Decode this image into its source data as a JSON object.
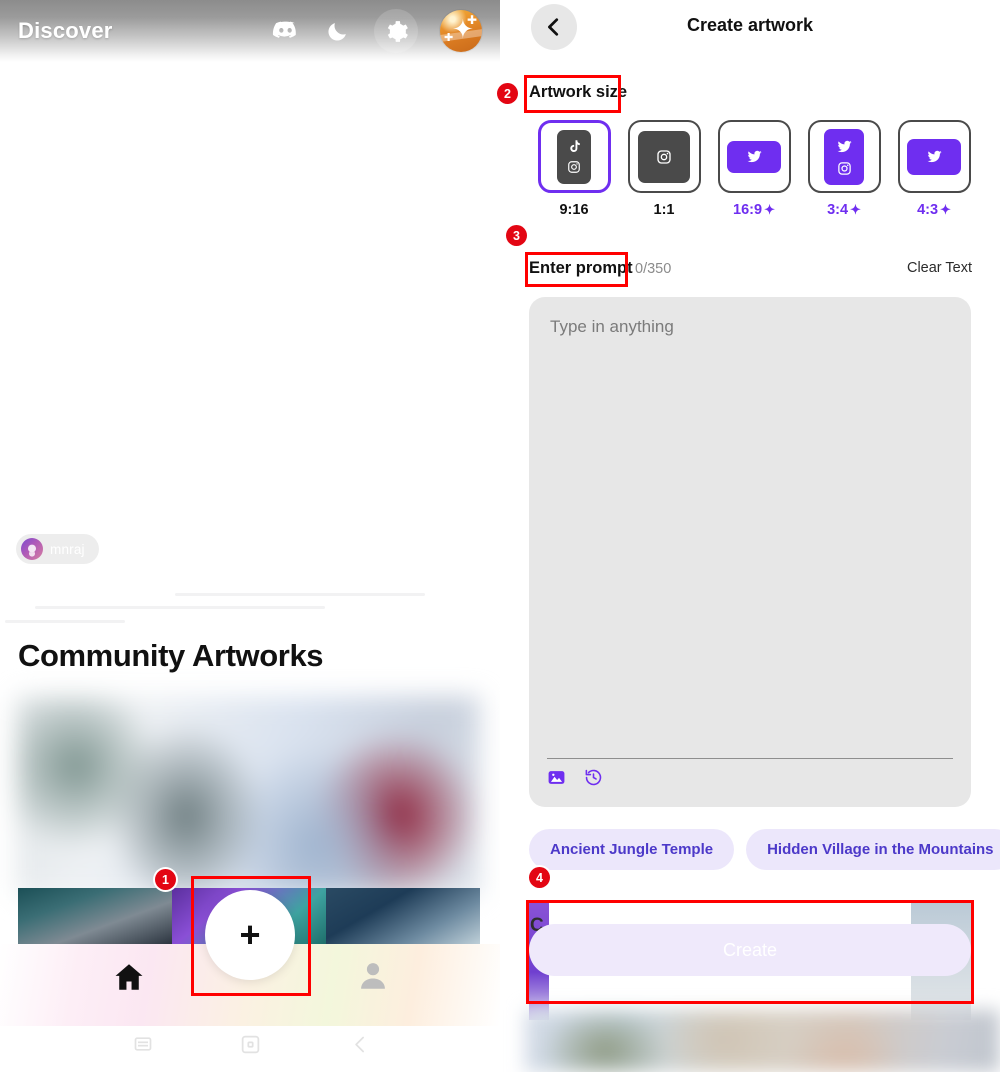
{
  "left": {
    "header": {
      "title": "Discover",
      "icons": [
        "discord-icon",
        "moon-icon",
        "gear-icon",
        "avatar"
      ]
    },
    "badge": {
      "username": "mnraj"
    },
    "section_title": "Community Artworks",
    "bottom_nav": {
      "home_label": "home-icon",
      "add_label": "+",
      "profile_label": "profile-icon"
    },
    "system_nav": {
      "recents": "recents-icon",
      "home": "home-square-icon",
      "back": "back-chevron-icon"
    }
  },
  "right": {
    "header": {
      "title": "Create artwork",
      "back": "back-chevron-icon"
    },
    "artwork_size": {
      "label": "Artwork size",
      "options": [
        {
          "ratio": "9:16",
          "pro": false,
          "selected": true,
          "fill": "dark",
          "icons": [
            "tiktok",
            "instagram"
          ]
        },
        {
          "ratio": "1:1",
          "pro": false,
          "selected": false,
          "fill": "dark",
          "icons": [
            "instagram"
          ]
        },
        {
          "ratio": "16:9",
          "pro": true,
          "selected": false,
          "fill": "purple",
          "icons": [
            "twitter"
          ]
        },
        {
          "ratio": "3:4",
          "pro": true,
          "selected": false,
          "fill": "purple",
          "icons": [
            "twitter",
            "instagram"
          ]
        },
        {
          "ratio": "4:3",
          "pro": true,
          "selected": false,
          "fill": "purple",
          "icons": [
            "twitter"
          ]
        }
      ],
      "pro_marker": "✦"
    },
    "prompt": {
      "label": "Enter prompt",
      "counter": "0/350",
      "clear_label": "Clear Text",
      "placeholder": "Type in anything",
      "value": "",
      "tools": [
        "image-icon",
        "history-icon"
      ]
    },
    "suggestions": [
      "Ancient Jungle Temple",
      "Hidden Village in the Mountains"
    ],
    "create_label": "Create",
    "behind_text": "C"
  },
  "annotations": [
    {
      "id": "1",
      "number": "1"
    },
    {
      "id": "2",
      "number": "2"
    },
    {
      "id": "3",
      "number": "3"
    },
    {
      "id": "4",
      "number": "4"
    }
  ],
  "colors": {
    "accent_purple": "#6f2ef0",
    "chip_text": "#4c39c9",
    "chip_bg": "#ece7fb",
    "annotation_red": "#e30613",
    "prompt_bg": "#e7e7e7"
  }
}
